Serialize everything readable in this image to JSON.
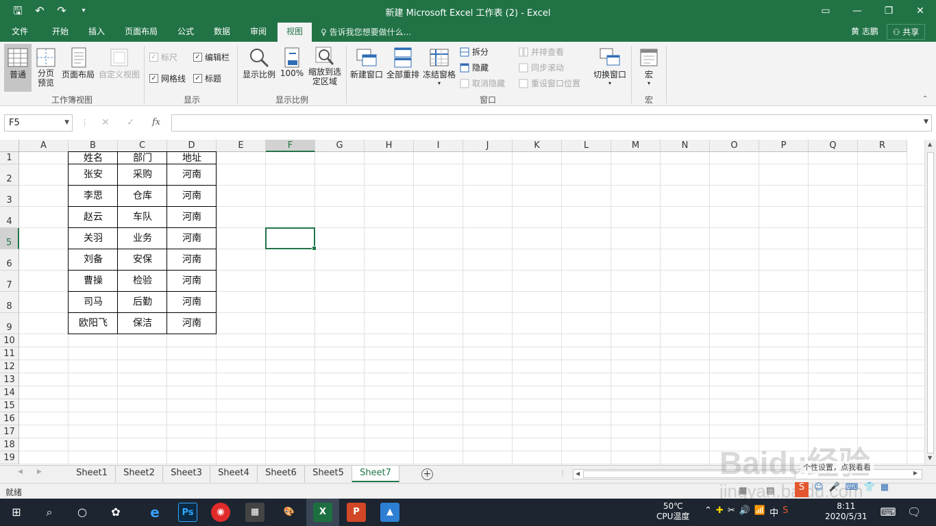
{
  "window": {
    "title": "新建 Microsoft Excel 工作表 (2) - Excel",
    "qat_icons": [
      "save-icon",
      "undo-icon",
      "redo-icon",
      "customize-icon"
    ]
  },
  "tabs": [
    {
      "label": "文件"
    },
    {
      "label": "开始"
    },
    {
      "label": "插入"
    },
    {
      "label": "页面布局"
    },
    {
      "label": "公式"
    },
    {
      "label": "数据"
    },
    {
      "label": "审阅"
    },
    {
      "label": "视图",
      "active": true
    }
  ],
  "tell_me": "告诉我您想要做什么...",
  "user": {
    "name": "黄 志鹏",
    "share_label": "共享"
  },
  "ribbon": {
    "workbook_views": {
      "label": "工作簿视图",
      "normal": "普通",
      "page_break": "分页预览",
      "page_layout": "页面布局",
      "custom_views": "自定义视图"
    },
    "show": {
      "label": "显示",
      "ruler": "标尺",
      "formula_bar": "编辑栏",
      "gridlines": "网格线",
      "headings": "标题"
    },
    "zoom": {
      "label": "显示比例",
      "zoom": "显示比例",
      "hundred": "100%",
      "zoom_to_selection": "缩放到选定区域"
    },
    "window": {
      "label": "窗口",
      "new_window": "新建窗口",
      "arrange_all": "全部重排",
      "freeze_panes": "冻结窗格",
      "split": "拆分",
      "hide": "隐藏",
      "unhide": "取消隐藏",
      "side_by_side": "并排查看",
      "sync_scroll": "同步滚动",
      "reset_position": "重设窗口位置",
      "switch_windows": "切换窗口"
    },
    "macros": {
      "label": "宏",
      "macros": "宏"
    }
  },
  "formula_bar": {
    "name_box": "F5",
    "fx": "fx",
    "value": ""
  },
  "columns": [
    "A",
    "B",
    "C",
    "D",
    "E",
    "F",
    "G",
    "H",
    "I",
    "J",
    "K",
    "L",
    "M",
    "N",
    "O",
    "P",
    "Q",
    "R"
  ],
  "selected_column": "F",
  "rows": [
    "1",
    "2",
    "3",
    "4",
    "5",
    "6",
    "7",
    "8",
    "9",
    "10",
    "11",
    "12",
    "13",
    "14",
    "15",
    "16",
    "17",
    "18",
    "19"
  ],
  "selected_row": "5",
  "table": {
    "header": [
      "姓名",
      "部门",
      "地址"
    ],
    "rows": [
      [
        "张安",
        "采购",
        "河南"
      ],
      [
        "李思",
        "仓库",
        "河南"
      ],
      [
        "赵云",
        "车队",
        "河南"
      ],
      [
        "关羽",
        "业务",
        "河南"
      ],
      [
        "刘备",
        "安保",
        "河南"
      ],
      [
        "曹操",
        "检验",
        "河南"
      ],
      [
        "司马",
        "后勤",
        "河南"
      ],
      [
        "欧阳飞",
        "保洁",
        "河南"
      ]
    ]
  },
  "sheets": [
    "Sheet1",
    "Sheet2",
    "Sheet3",
    "Sheet4",
    "Sheet6",
    "Sheet5",
    "Sheet7"
  ],
  "active_sheet": "Sheet7",
  "status": "就绪",
  "watermark": {
    "brand": "Baidu经验",
    "url": "jingyan.baidu.com",
    "note": "个性设置，点我看看"
  },
  "taskbar": {
    "cpu_temp": "50℃",
    "cpu_label": "CPU温度",
    "ime": "中",
    "time": "8:11",
    "date": "2020/5/31"
  },
  "colors": {
    "excel_green": "#217346",
    "taskbar": "#1c2530"
  }
}
